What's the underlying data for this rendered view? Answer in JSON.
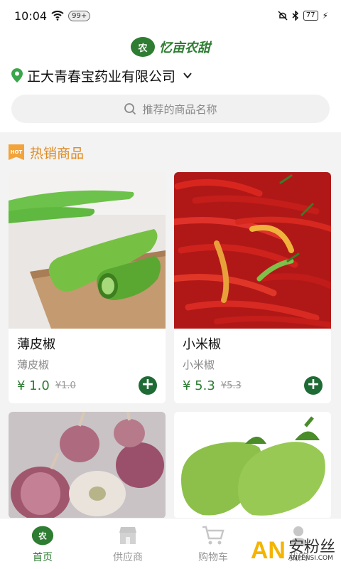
{
  "status_bar": {
    "time": "10:04",
    "notif_count": "99+",
    "battery": "77"
  },
  "header": {
    "logo_text": "忆亩农甜",
    "logo_mark": "农"
  },
  "location": {
    "name": "正大青春宝药业有限公司"
  },
  "search": {
    "placeholder": "推荐的商品名称"
  },
  "section": {
    "title": "热销商品",
    "hot_label": "HOT"
  },
  "products": [
    {
      "name": "薄皮椒",
      "subtitle": "薄皮椒",
      "price": "¥ 1.0",
      "old_price": "¥1.0"
    },
    {
      "name": "小米椒",
      "subtitle": "小米椒",
      "price": "¥ 5.3",
      "old_price": "¥5.3"
    },
    {
      "name": "",
      "subtitle": "",
      "price": "",
      "old_price": ""
    },
    {
      "name": "",
      "subtitle": "",
      "price": "",
      "old_price": ""
    }
  ],
  "bottom_nav": [
    {
      "label": "首页",
      "icon": "home-icon",
      "active": true
    },
    {
      "label": "供应商",
      "icon": "store-icon",
      "active": false
    },
    {
      "label": "购物车",
      "icon": "cart-icon",
      "active": false
    },
    {
      "label": "我的",
      "icon": "user-icon",
      "active": false
    }
  ],
  "watermark": {
    "brand": "AN",
    "cn": "安粉丝",
    "url": "ANFENSI.COM"
  },
  "colors": {
    "brand_green": "#2e7d32",
    "accent_orange": "#e08a1e"
  }
}
